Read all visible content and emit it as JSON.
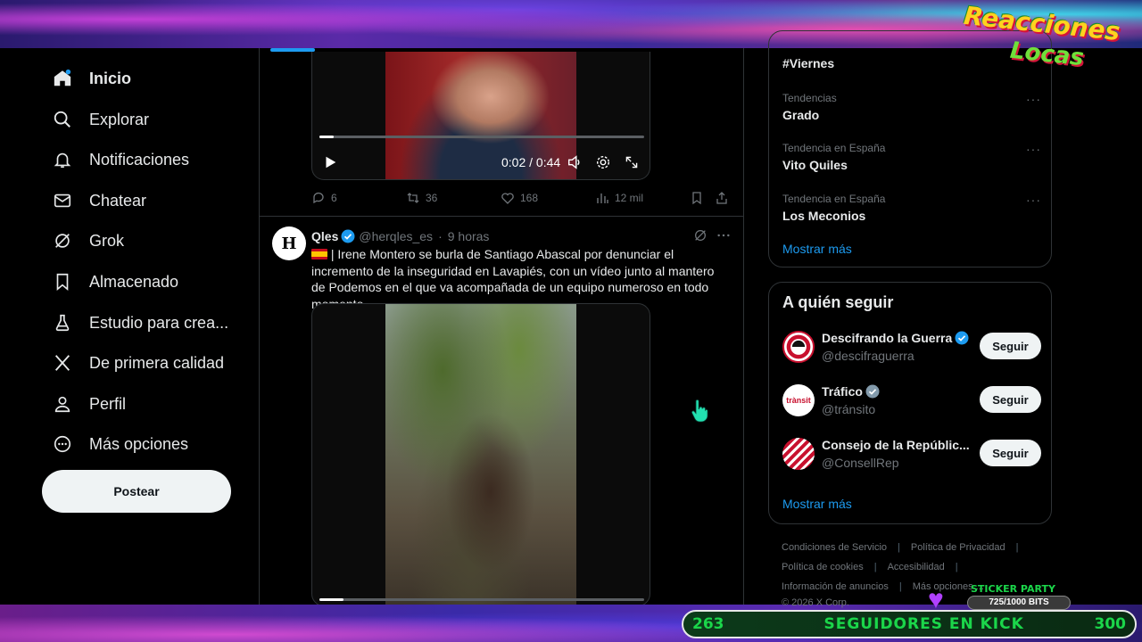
{
  "overlay": {
    "logo_line1": "Reacciones",
    "logo_line2": "Locas",
    "kick_current": "263",
    "kick_label": "SEGUIDORES EN KICK",
    "kick_goal": "300",
    "sticker_title": "STICKER PARTY",
    "sticker_bits": "725/1000 BITS"
  },
  "nav": {
    "items": [
      {
        "label": "Inicio",
        "icon": "home-icon"
      },
      {
        "label": "Explorar",
        "icon": "search-icon"
      },
      {
        "label": "Notificaciones",
        "icon": "bell-icon"
      },
      {
        "label": "Chatear",
        "icon": "mail-icon"
      },
      {
        "label": "Grok",
        "icon": "grok-icon"
      },
      {
        "label": "Almacenado",
        "icon": "bookmark-icon"
      },
      {
        "label": "Estudio para crea...",
        "icon": "flask-icon"
      },
      {
        "label": "De primera calidad",
        "icon": "x-logo-icon"
      },
      {
        "label": "Perfil",
        "icon": "person-icon"
      },
      {
        "label": "Más opciones",
        "icon": "more-circle-icon"
      }
    ],
    "post_label": "Postear"
  },
  "tweet1": {
    "video_time": "0:02 / 0:44",
    "video_progress": 0.045,
    "replies": "6",
    "reposts": "36",
    "likes": "168",
    "views": "12 mil"
  },
  "tweet2": {
    "name": "Qles",
    "handle": "@herqles_es",
    "time": "9 horas",
    "text": "| Irene Montero se burla de Santiago Abascal por denunciar el incremento de la inseguridad en Lavapiés, con un vídeo junto al mantero de Podemos en el que va acompañada de un equipo numeroso en todo momento.",
    "video_progress": 0.075
  },
  "trends": {
    "first_name": "#Viernes",
    "items": [
      {
        "category": "Tendencias",
        "name": "Grado"
      },
      {
        "category": "Tendencia en España",
        "name": "Vito Quiles"
      },
      {
        "category": "Tendencia en España",
        "name": "Los Meconios"
      }
    ],
    "show_more": "Mostrar más"
  },
  "who_to_follow": {
    "title": "A quién seguir",
    "accounts": [
      {
        "name": "Descifrando la Guerra",
        "handle": "@descifraguerra",
        "verified_color": "#1d9bf0"
      },
      {
        "name": "Tráfico",
        "handle": "@tránsito",
        "avatar_text": "trànsit",
        "verified_color": "#829aab"
      },
      {
        "name": "Consejo de la Repúblic...",
        "handle": "@ConsellRep"
      }
    ],
    "follow_label": "Seguir",
    "show_more": "Mostrar más"
  },
  "footer": {
    "links": [
      "Condiciones de Servicio",
      "Política de Privacidad",
      "Política de cookies",
      "Accesibilidad",
      "Información de anuncios",
      "Más opciones ..."
    ],
    "copyright": "© 2026 X Corp."
  },
  "colors": {
    "accent": "#1d9bf0",
    "kick_green": "#1bd64a"
  }
}
